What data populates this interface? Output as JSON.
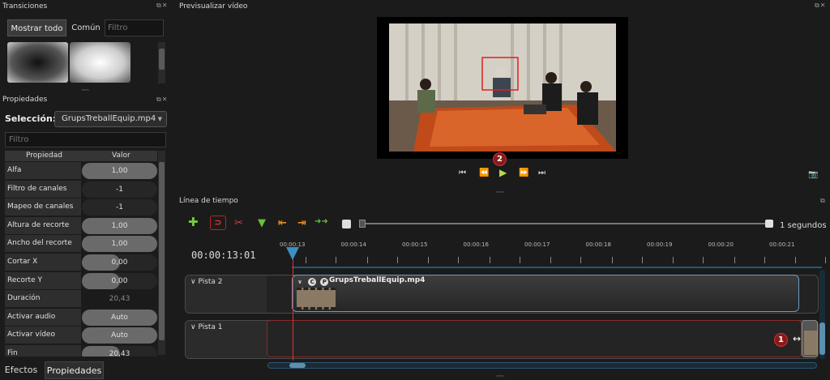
{
  "transitions": {
    "title": "Transiciones",
    "tab_all": "Mostrar todo",
    "tab_common": "Común",
    "filter_placeholder": "Filtro"
  },
  "properties": {
    "title": "Propiedades",
    "selection_label": "Selección:",
    "selection_value": "GrupsTreballEquip.mp4",
    "filter_placeholder": "Filtro",
    "col_property": "Propiedad",
    "col_value": "Valor",
    "rows": [
      {
        "name": "Alfa",
        "value": "1,00",
        "fill": 1.0
      },
      {
        "name": "Filtro de canales",
        "value": "-1",
        "fill": 0
      },
      {
        "name": "Mapeo de canales",
        "value": "-1",
        "fill": 0
      },
      {
        "name": "Altura de recorte",
        "value": "1,00",
        "fill": 1.0
      },
      {
        "name": "Ancho del recorte",
        "value": "1,00",
        "fill": 1.0
      },
      {
        "name": "Cortar X",
        "value": "0,00",
        "fill": 0.5
      },
      {
        "name": "Recorte Y",
        "value": "0,00",
        "fill": 0.5
      },
      {
        "name": "Duración",
        "value": "20,43",
        "fill": -1
      },
      {
        "name": "Activar audio",
        "value": "Auto",
        "fill": 1.0
      },
      {
        "name": "Activar vídeo",
        "value": "Auto",
        "fill": 1.0
      },
      {
        "name": "Fin",
        "value": "20,43",
        "fill": 0.5
      }
    ]
  },
  "bottom_tabs": {
    "effects": "Efectos",
    "properties": "Propiedades"
  },
  "preview": {
    "title": "Previsualizar vídeo",
    "badge": "2"
  },
  "timeline": {
    "title": "Línea de tiempo",
    "zoom_label": "1 segundos",
    "timecode": "00:00:13:01",
    "ruler_labels": [
      "00:00:13",
      "00:00:14",
      "00:00:15",
      "00:00:16",
      "00:00:17",
      "00:00:18",
      "00:00:19",
      "00:00:20",
      "00:00:21"
    ],
    "tracks": [
      {
        "name": "Pista 2"
      },
      {
        "name": "Pista 1"
      }
    ],
    "clip_name": "GrupsTreballEquip.mp4",
    "clip_badge_c": "C",
    "clip_badge_p": "P",
    "badge": "1"
  },
  "colors": {
    "accent": "#3d8fc2",
    "playhead": "#dd3333",
    "badge": "#8a1a1a",
    "play": "#b8d94a"
  }
}
